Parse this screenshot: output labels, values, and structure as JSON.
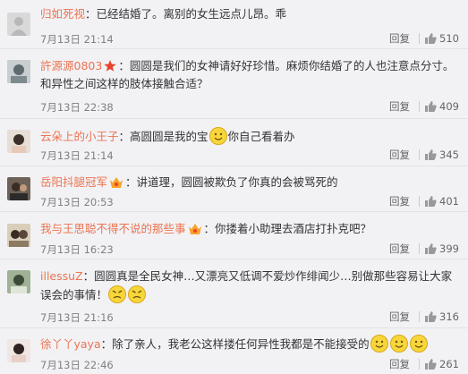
{
  "actions": {
    "reply_label": "回复"
  },
  "colors": {
    "username": "#eb7350",
    "text": "#333333",
    "meta": "#808080",
    "background": "#f2f2f5"
  },
  "comments": [
    {
      "username": "归如死视",
      "text": "：已经结婚了。离别的女生远点儿昂。乖",
      "time": "7月13日 21:14",
      "likes": "510",
      "avatar_icon": "default-avatar-icon"
    },
    {
      "username": "許源源0803",
      "badge_icon": "star-badge-icon",
      "text": "：圆圆是我们的女神请好好珍惜。麻烦你结婚了的人也注意点分寸。和异性之间这样的肢体接触合适？",
      "time": "7月13日 22:38",
      "likes": "409",
      "avatar_icon": "user-photo-avatar"
    },
    {
      "username": "云朵上的小王子",
      "text": "：高圆圆是我的宝",
      "text2": "你自己看着办",
      "emoji_icon": "smile-emoji-icon",
      "time": "7月13日 21:14",
      "likes": "345",
      "avatar_icon": "user-photo-avatar"
    },
    {
      "username": "岳阳抖腿冠军",
      "badge_icon": "vip-badge-icon",
      "text": "：讲道理，圆圆被欺负了你真的会被骂死的",
      "time": "7月13日 20:53",
      "likes": "401",
      "avatar_icon": "user-photo-avatar"
    },
    {
      "username": "我与王思聪不得不说的那些事",
      "badge_icon": "vip-badge-icon",
      "text": "：你搂着小助理去酒店打扑克吧？",
      "time": "7月13日 16:23",
      "likes": "399",
      "avatar_icon": "user-photo-avatar"
    },
    {
      "username": "illessuZ",
      "text": "：圆圆真是全民女神…又漂亮又低调不爱炒作绯闻少…别做那些容易让大家误会的事情！",
      "emoji_icon": "angry-emoji-icon",
      "time": "7月13日 21:16",
      "likes": "316",
      "avatar_icon": "user-photo-avatar"
    },
    {
      "username": "徐丫丫yaya",
      "text": "：除了亲人，我老公这样搂任何异性我都是不能接受的",
      "emoji_icon": "smile-emoji-icon",
      "time": "7月13日 22:46",
      "likes": "261",
      "avatar_icon": "user-photo-avatar"
    }
  ]
}
